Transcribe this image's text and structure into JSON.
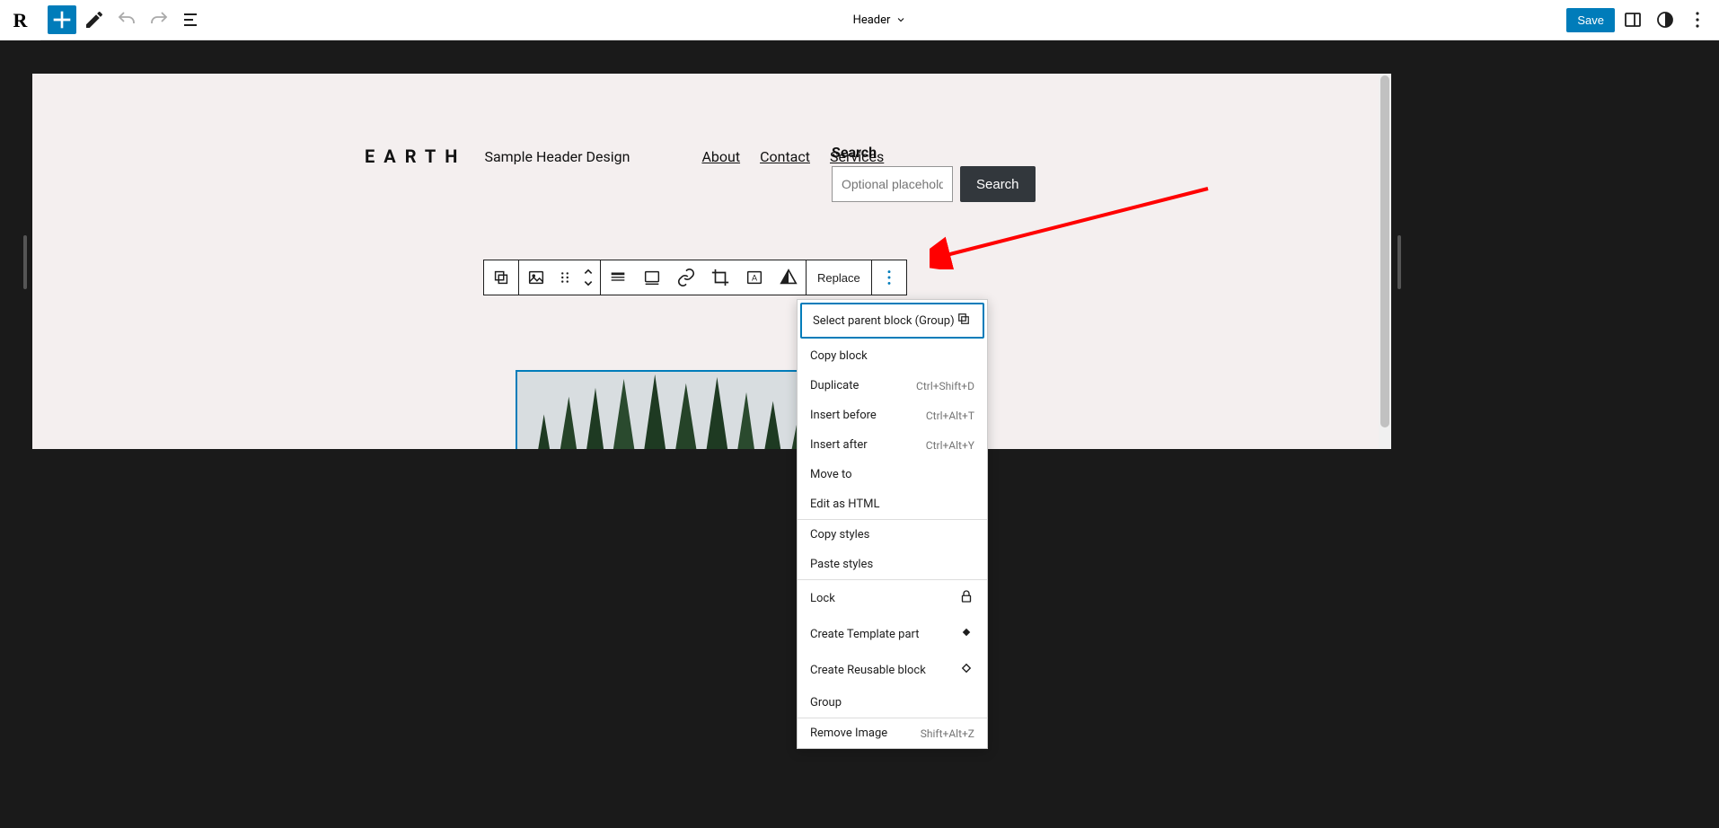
{
  "topbar": {
    "doc_title": "Header",
    "save_label": "Save"
  },
  "logo": "R",
  "header": {
    "site_title": "EARTH",
    "tagline": "Sample Header Design",
    "nav": [
      "About",
      "Contact",
      "Services"
    ]
  },
  "search": {
    "label": "Search",
    "placeholder": "Optional placeholder…",
    "button": "Search"
  },
  "block_toolbar": {
    "replace": "Replace"
  },
  "context_menu": {
    "select_parent": "Select parent block (Group)",
    "copy_block": "Copy block",
    "duplicate": {
      "label": "Duplicate",
      "shortcut": "Ctrl+Shift+D"
    },
    "insert_before": {
      "label": "Insert before",
      "shortcut": "Ctrl+Alt+T"
    },
    "insert_after": {
      "label": "Insert after",
      "shortcut": "Ctrl+Alt+Y"
    },
    "move_to": "Move to",
    "edit_html": "Edit as HTML",
    "copy_styles": "Copy styles",
    "paste_styles": "Paste styles",
    "lock": "Lock",
    "create_template": "Create Template part",
    "create_reusable": "Create Reusable block",
    "group": "Group",
    "remove": {
      "label": "Remove Image",
      "shortcut": "Shift+Alt+Z"
    }
  }
}
